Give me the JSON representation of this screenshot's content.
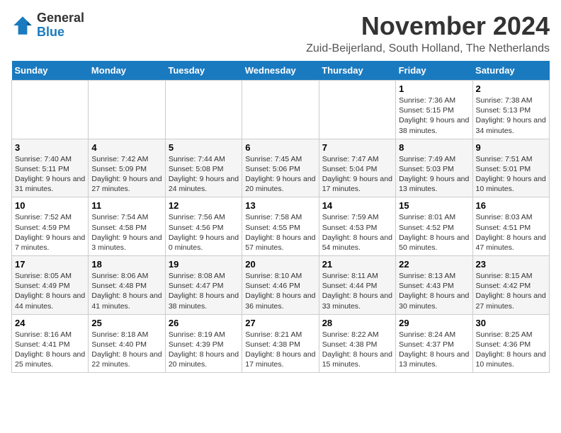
{
  "logo": {
    "general": "General",
    "blue": "Blue"
  },
  "title": "November 2024",
  "location": "Zuid-Beijerland, South Holland, The Netherlands",
  "weekdays": [
    "Sunday",
    "Monday",
    "Tuesday",
    "Wednesday",
    "Thursday",
    "Friday",
    "Saturday"
  ],
  "weeks": [
    [
      {
        "day": "",
        "info": ""
      },
      {
        "day": "",
        "info": ""
      },
      {
        "day": "",
        "info": ""
      },
      {
        "day": "",
        "info": ""
      },
      {
        "day": "",
        "info": ""
      },
      {
        "day": "1",
        "info": "Sunrise: 7:36 AM\nSunset: 5:15 PM\nDaylight: 9 hours and 38 minutes."
      },
      {
        "day": "2",
        "info": "Sunrise: 7:38 AM\nSunset: 5:13 PM\nDaylight: 9 hours and 34 minutes."
      }
    ],
    [
      {
        "day": "3",
        "info": "Sunrise: 7:40 AM\nSunset: 5:11 PM\nDaylight: 9 hours and 31 minutes."
      },
      {
        "day": "4",
        "info": "Sunrise: 7:42 AM\nSunset: 5:09 PM\nDaylight: 9 hours and 27 minutes."
      },
      {
        "day": "5",
        "info": "Sunrise: 7:44 AM\nSunset: 5:08 PM\nDaylight: 9 hours and 24 minutes."
      },
      {
        "day": "6",
        "info": "Sunrise: 7:45 AM\nSunset: 5:06 PM\nDaylight: 9 hours and 20 minutes."
      },
      {
        "day": "7",
        "info": "Sunrise: 7:47 AM\nSunset: 5:04 PM\nDaylight: 9 hours and 17 minutes."
      },
      {
        "day": "8",
        "info": "Sunrise: 7:49 AM\nSunset: 5:03 PM\nDaylight: 9 hours and 13 minutes."
      },
      {
        "day": "9",
        "info": "Sunrise: 7:51 AM\nSunset: 5:01 PM\nDaylight: 9 hours and 10 minutes."
      }
    ],
    [
      {
        "day": "10",
        "info": "Sunrise: 7:52 AM\nSunset: 4:59 PM\nDaylight: 9 hours and 7 minutes."
      },
      {
        "day": "11",
        "info": "Sunrise: 7:54 AM\nSunset: 4:58 PM\nDaylight: 9 hours and 3 minutes."
      },
      {
        "day": "12",
        "info": "Sunrise: 7:56 AM\nSunset: 4:56 PM\nDaylight: 9 hours and 0 minutes."
      },
      {
        "day": "13",
        "info": "Sunrise: 7:58 AM\nSunset: 4:55 PM\nDaylight: 8 hours and 57 minutes."
      },
      {
        "day": "14",
        "info": "Sunrise: 7:59 AM\nSunset: 4:53 PM\nDaylight: 8 hours and 54 minutes."
      },
      {
        "day": "15",
        "info": "Sunrise: 8:01 AM\nSunset: 4:52 PM\nDaylight: 8 hours and 50 minutes."
      },
      {
        "day": "16",
        "info": "Sunrise: 8:03 AM\nSunset: 4:51 PM\nDaylight: 8 hours and 47 minutes."
      }
    ],
    [
      {
        "day": "17",
        "info": "Sunrise: 8:05 AM\nSunset: 4:49 PM\nDaylight: 8 hours and 44 minutes."
      },
      {
        "day": "18",
        "info": "Sunrise: 8:06 AM\nSunset: 4:48 PM\nDaylight: 8 hours and 41 minutes."
      },
      {
        "day": "19",
        "info": "Sunrise: 8:08 AM\nSunset: 4:47 PM\nDaylight: 8 hours and 38 minutes."
      },
      {
        "day": "20",
        "info": "Sunrise: 8:10 AM\nSunset: 4:46 PM\nDaylight: 8 hours and 36 minutes."
      },
      {
        "day": "21",
        "info": "Sunrise: 8:11 AM\nSunset: 4:44 PM\nDaylight: 8 hours and 33 minutes."
      },
      {
        "day": "22",
        "info": "Sunrise: 8:13 AM\nSunset: 4:43 PM\nDaylight: 8 hours and 30 minutes."
      },
      {
        "day": "23",
        "info": "Sunrise: 8:15 AM\nSunset: 4:42 PM\nDaylight: 8 hours and 27 minutes."
      }
    ],
    [
      {
        "day": "24",
        "info": "Sunrise: 8:16 AM\nSunset: 4:41 PM\nDaylight: 8 hours and 25 minutes."
      },
      {
        "day": "25",
        "info": "Sunrise: 8:18 AM\nSunset: 4:40 PM\nDaylight: 8 hours and 22 minutes."
      },
      {
        "day": "26",
        "info": "Sunrise: 8:19 AM\nSunset: 4:39 PM\nDaylight: 8 hours and 20 minutes."
      },
      {
        "day": "27",
        "info": "Sunrise: 8:21 AM\nSunset: 4:38 PM\nDaylight: 8 hours and 17 minutes."
      },
      {
        "day": "28",
        "info": "Sunrise: 8:22 AM\nSunset: 4:38 PM\nDaylight: 8 hours and 15 minutes."
      },
      {
        "day": "29",
        "info": "Sunrise: 8:24 AM\nSunset: 4:37 PM\nDaylight: 8 hours and 13 minutes."
      },
      {
        "day": "30",
        "info": "Sunrise: 8:25 AM\nSunset: 4:36 PM\nDaylight: 8 hours and 10 minutes."
      }
    ]
  ]
}
